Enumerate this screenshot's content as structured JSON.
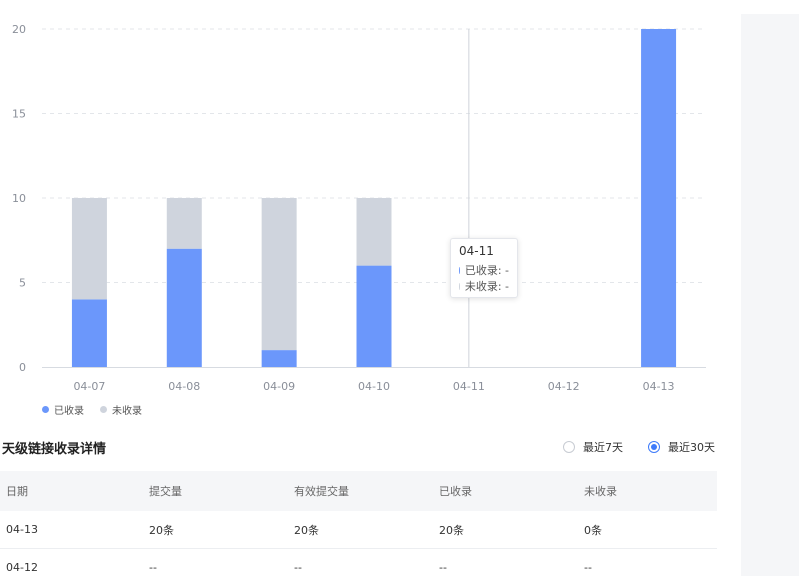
{
  "chart_data": {
    "type": "bar",
    "stacked": true,
    "categories": [
      "04-07",
      "04-08",
      "04-09",
      "04-10",
      "04-11",
      "04-12",
      "04-13"
    ],
    "series": [
      {
        "name": "已收录",
        "values": [
          4,
          7,
          1,
          6,
          null,
          null,
          20
        ],
        "color": "#6b97fb"
      },
      {
        "name": "未收录",
        "values": [
          6,
          3,
          9,
          4,
          null,
          null,
          0
        ],
        "color": "#cfd4dd"
      }
    ],
    "yticks": [
      "0",
      "5",
      "10",
      "15",
      "20"
    ],
    "ylim": [
      0,
      20
    ],
    "grid": true,
    "legend_position": "bottom-left",
    "highlight_category": "04-11"
  },
  "tooltip": {
    "title": "04-11",
    "rows": [
      {
        "label": "已收录: -",
        "color": "#6b97fb"
      },
      {
        "label": "未收录: -",
        "color": "#cfd4dd"
      }
    ]
  },
  "legend": {
    "items": [
      {
        "label": "已收录",
        "color": "#6b97fb"
      },
      {
        "label": "未收录",
        "color": "#cfd4dd"
      }
    ]
  },
  "section": {
    "title": "天级链接收录详情",
    "radios": [
      {
        "label": "最近7天",
        "checked": false
      },
      {
        "label": "最近30天",
        "checked": true
      }
    ]
  },
  "table": {
    "headers": [
      "日期",
      "提交量",
      "有效提交量",
      "已收录",
      "未收录"
    ],
    "rows": [
      [
        "04-13",
        "20条",
        "20条",
        "20条",
        "0条"
      ],
      [
        "04-12",
        "--",
        "--",
        "--",
        "--"
      ]
    ]
  }
}
